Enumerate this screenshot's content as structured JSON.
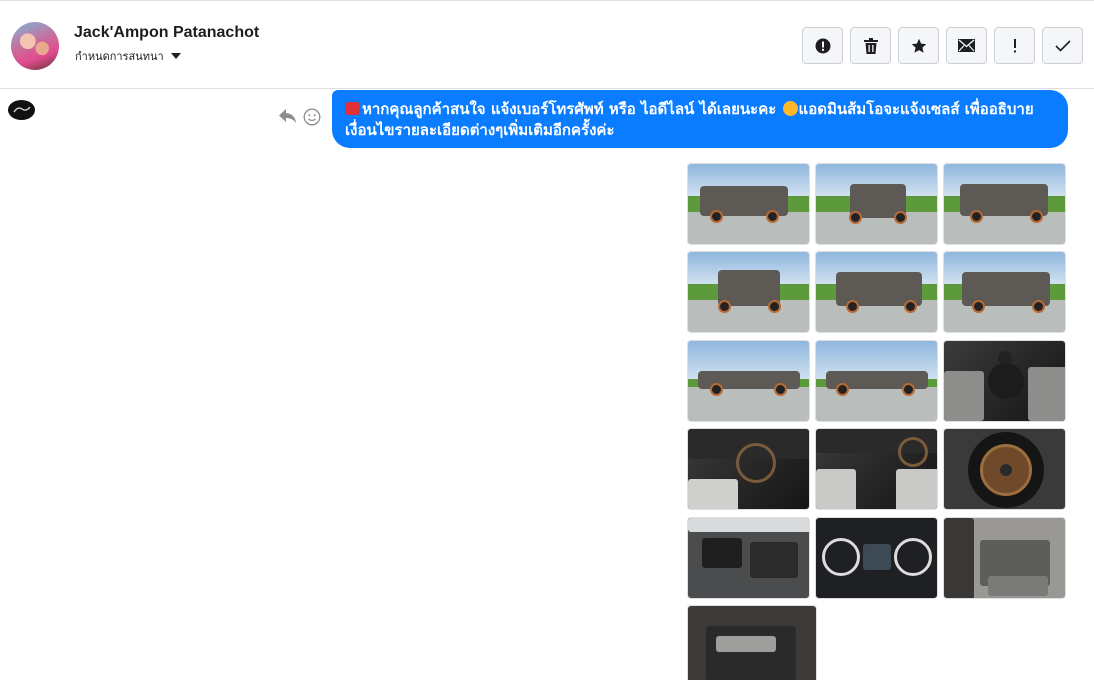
{
  "header": {
    "contact_name": "Jack'Ampon Patanachot",
    "assign_label": "กำหนดการสนทนา",
    "actions": [
      {
        "name": "report-button",
        "icon": "alert-circle-icon"
      },
      {
        "name": "delete-button",
        "icon": "trash-icon"
      },
      {
        "name": "star-button",
        "icon": "star-icon"
      },
      {
        "name": "mark-unread-button",
        "icon": "envelope-icon"
      },
      {
        "name": "important-button",
        "icon": "exclamation-icon"
      },
      {
        "name": "done-button",
        "icon": "check-icon"
      }
    ]
  },
  "message": {
    "line1": "หากคุณลูกค้าสนใจ แจ้งเบอร์โทรศัพท์ หรือ ไอดีไลน์  ได้เลยนะคะ",
    "line1_b": "แอดมินส้มโอจะแจ้งเซลส์   เพื่ออธิบาย",
    "line2": "เงื่อนไขรายละเอียดต่างๆเพิ่มเติมอีกครั้งค่ะ",
    "bubble_color": "#0a7cff"
  },
  "attachments": {
    "count": 16,
    "items": [
      "truck-front-left-photo",
      "truck-front-photo",
      "truck-rear-right-photo",
      "truck-rear-photo",
      "truck-rear-left-photo",
      "truck-rear-left-2-photo",
      "truck-side-photo",
      "truck-side-2-photo",
      "gear-shifter-photo",
      "dashboard-left-photo",
      "dashboard-center-photo",
      "bronze-wheel-photo",
      "engine-bay-photo",
      "instrument-cluster-photo",
      "rear-seat-photo",
      "door-panel-photo"
    ]
  }
}
